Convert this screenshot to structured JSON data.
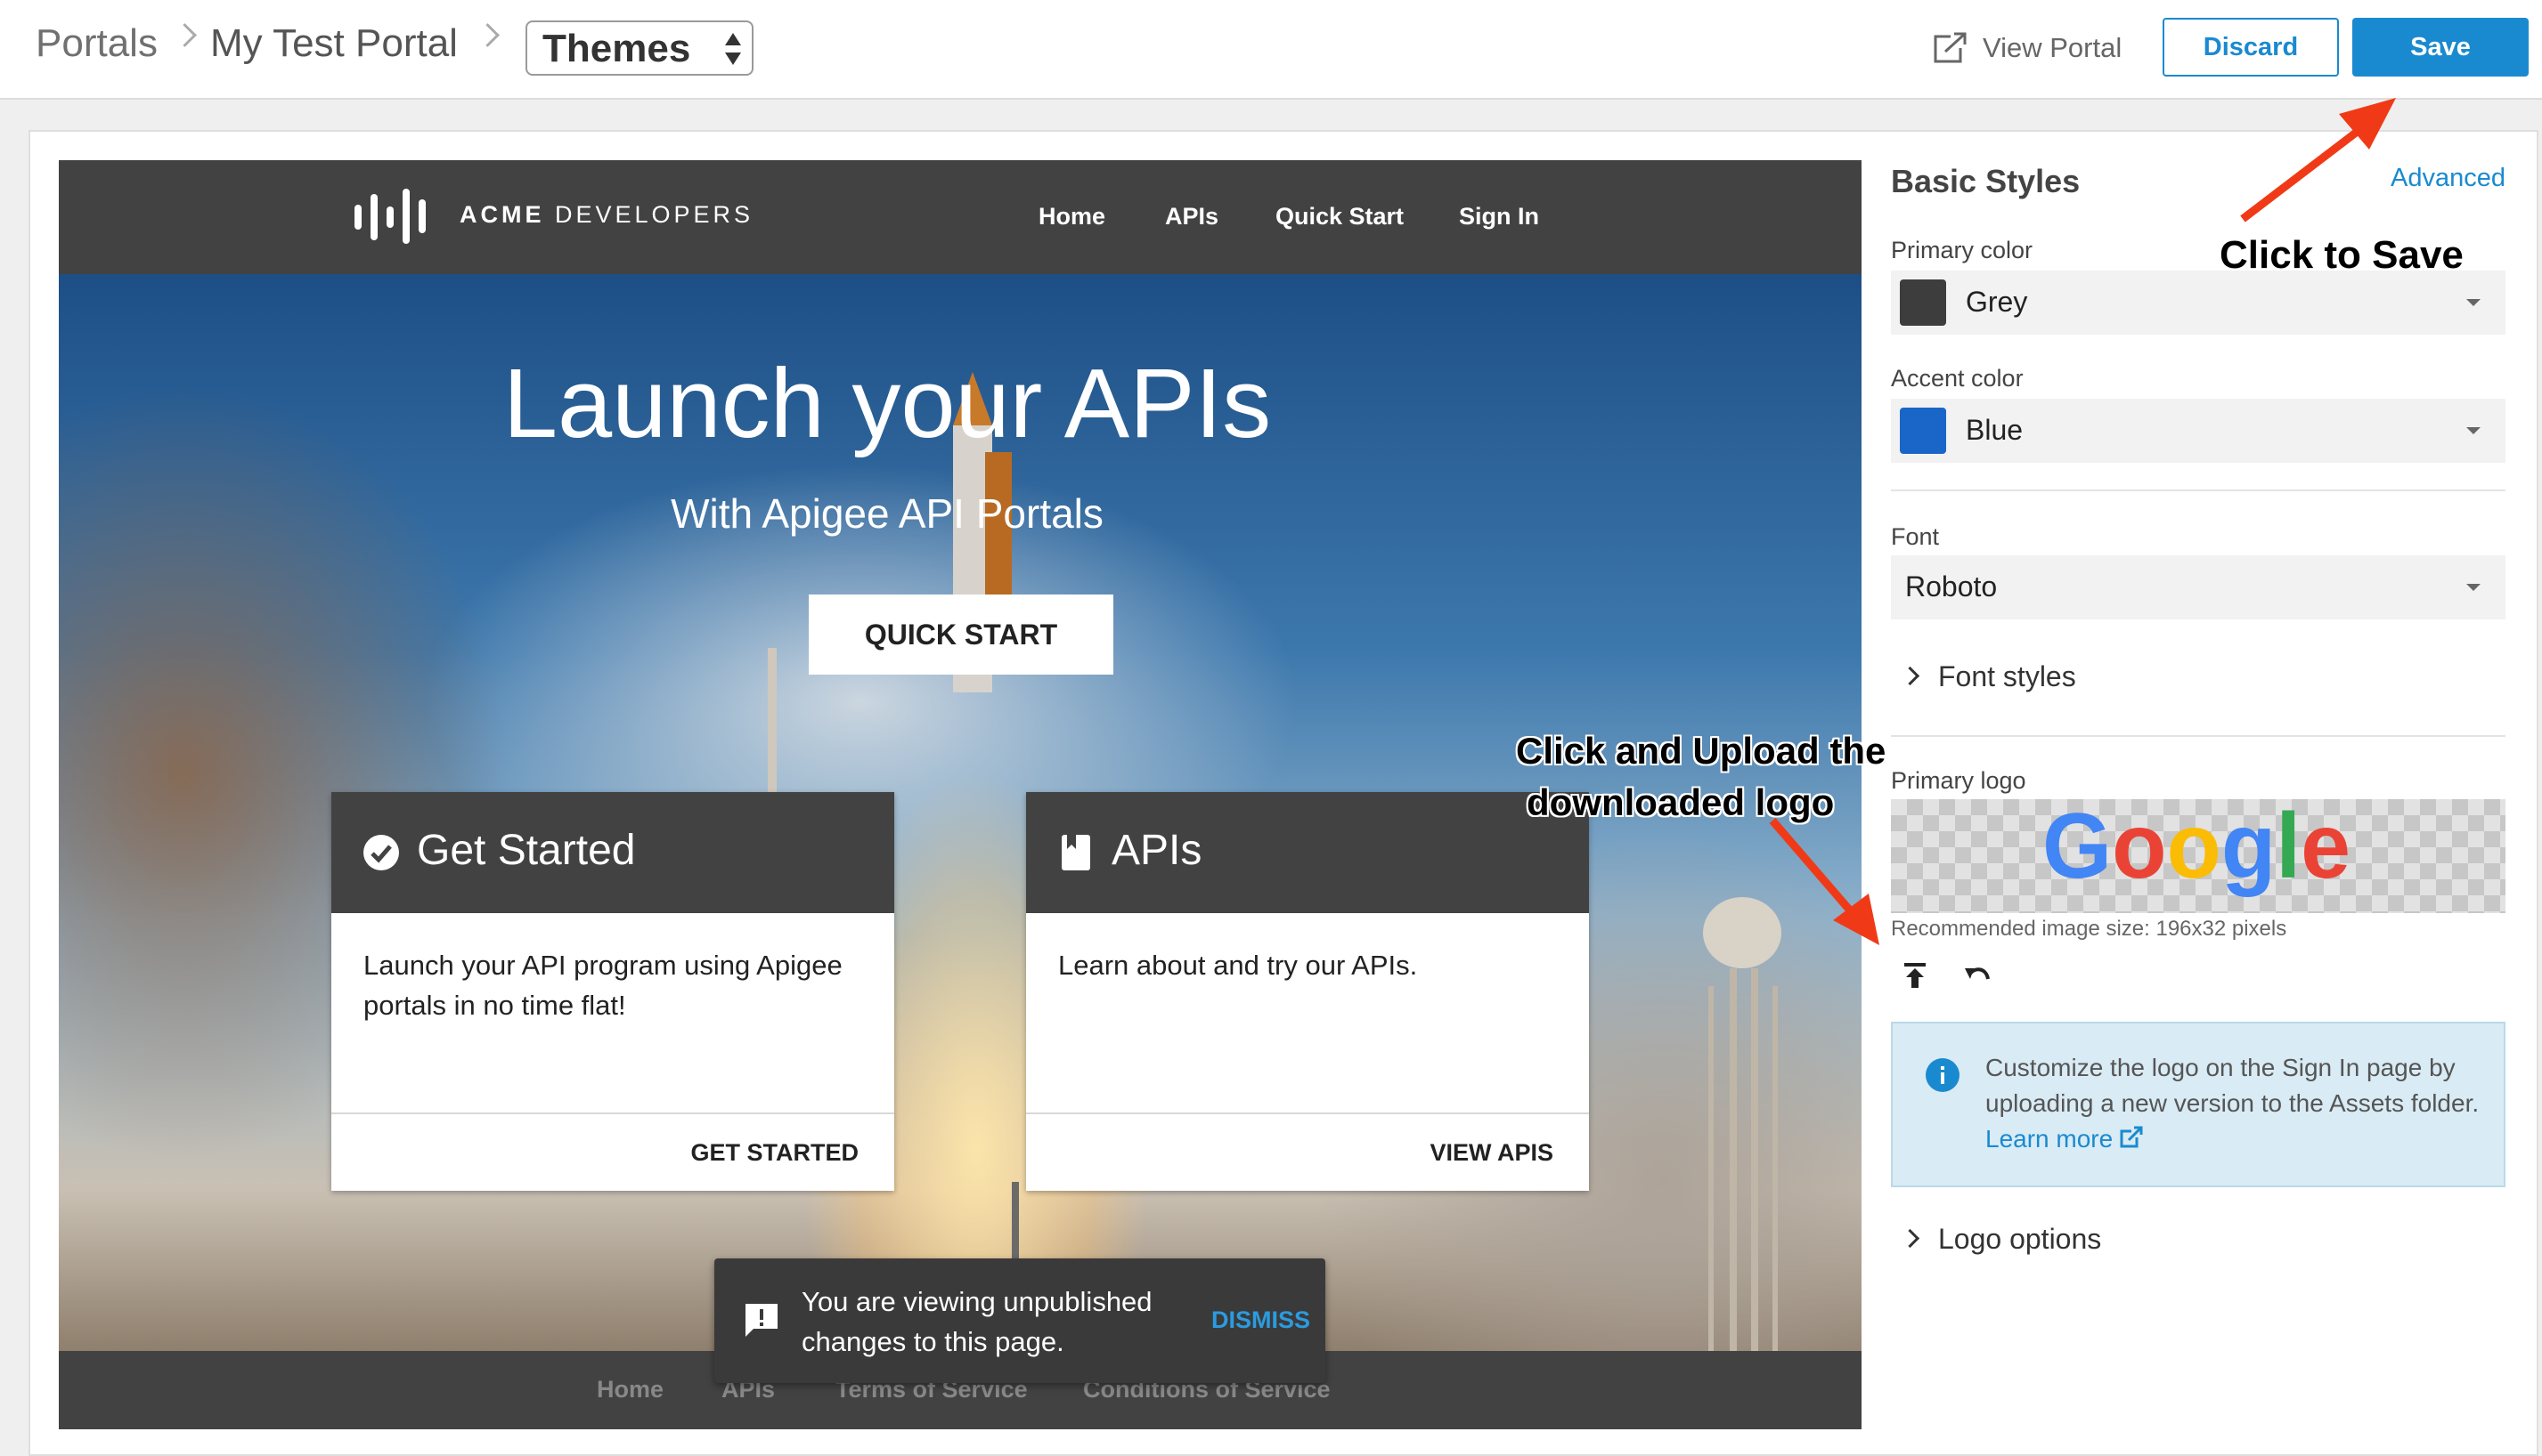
{
  "breadcrumb": {
    "items": [
      "Portals",
      "My Test Portal"
    ],
    "current_select": "Themes"
  },
  "toolbar": {
    "view_portal_label": "View Portal",
    "discard_label": "Discard",
    "save_label": "Save"
  },
  "preview": {
    "brand_strong": "ACME",
    "brand_rest": " DEVELOPERS",
    "nav": [
      "Home",
      "APIs",
      "Quick Start",
      "Sign In"
    ],
    "hero_title": "Launch your APIs",
    "hero_subtitle": "With Apigee API Portals",
    "hero_button": "QUICK START",
    "cards": [
      {
        "title": "Get Started",
        "body": "Launch your API program using Apigee portals in no time flat!",
        "link": "GET STARTED"
      },
      {
        "title": "APIs",
        "body": "Learn about and try our APIs.",
        "link": "VIEW APIS"
      }
    ],
    "footer_links": [
      "Home",
      "APIs",
      "Terms of Service",
      "Conditions of Service"
    ],
    "toast": {
      "message": "You are viewing unpublished changes to this page.",
      "dismiss": "DISMISS"
    }
  },
  "panel": {
    "title": "Basic Styles",
    "advanced_link": "Advanced",
    "primary_color": {
      "label": "Primary color",
      "value": "Grey",
      "swatch": "#3d3d3d"
    },
    "accent_color": {
      "label": "Accent color",
      "value": "Blue",
      "swatch": "#1a66c8"
    },
    "font": {
      "label": "Font",
      "value": "Roboto"
    },
    "font_styles_label": "Font styles",
    "primary_logo": {
      "label": "Primary logo",
      "logo_text": "Google",
      "recommended_size": "Recommended image size: 196x32 pixels"
    },
    "info": {
      "text": "Customize the logo on the Sign In page by uploading a new version to the Assets folder.",
      "learn_more": "Learn more"
    },
    "logo_options_label": "Logo options"
  },
  "annotations": {
    "save_hint": "Click to Save",
    "upload_hint_line1": "Click and Upload the",
    "upload_hint_line2": "downloaded logo"
  },
  "colors": {
    "accent_blue": "#1a8ad0",
    "header_dark": "#424242",
    "annotation_arrow": "#f03a17"
  }
}
